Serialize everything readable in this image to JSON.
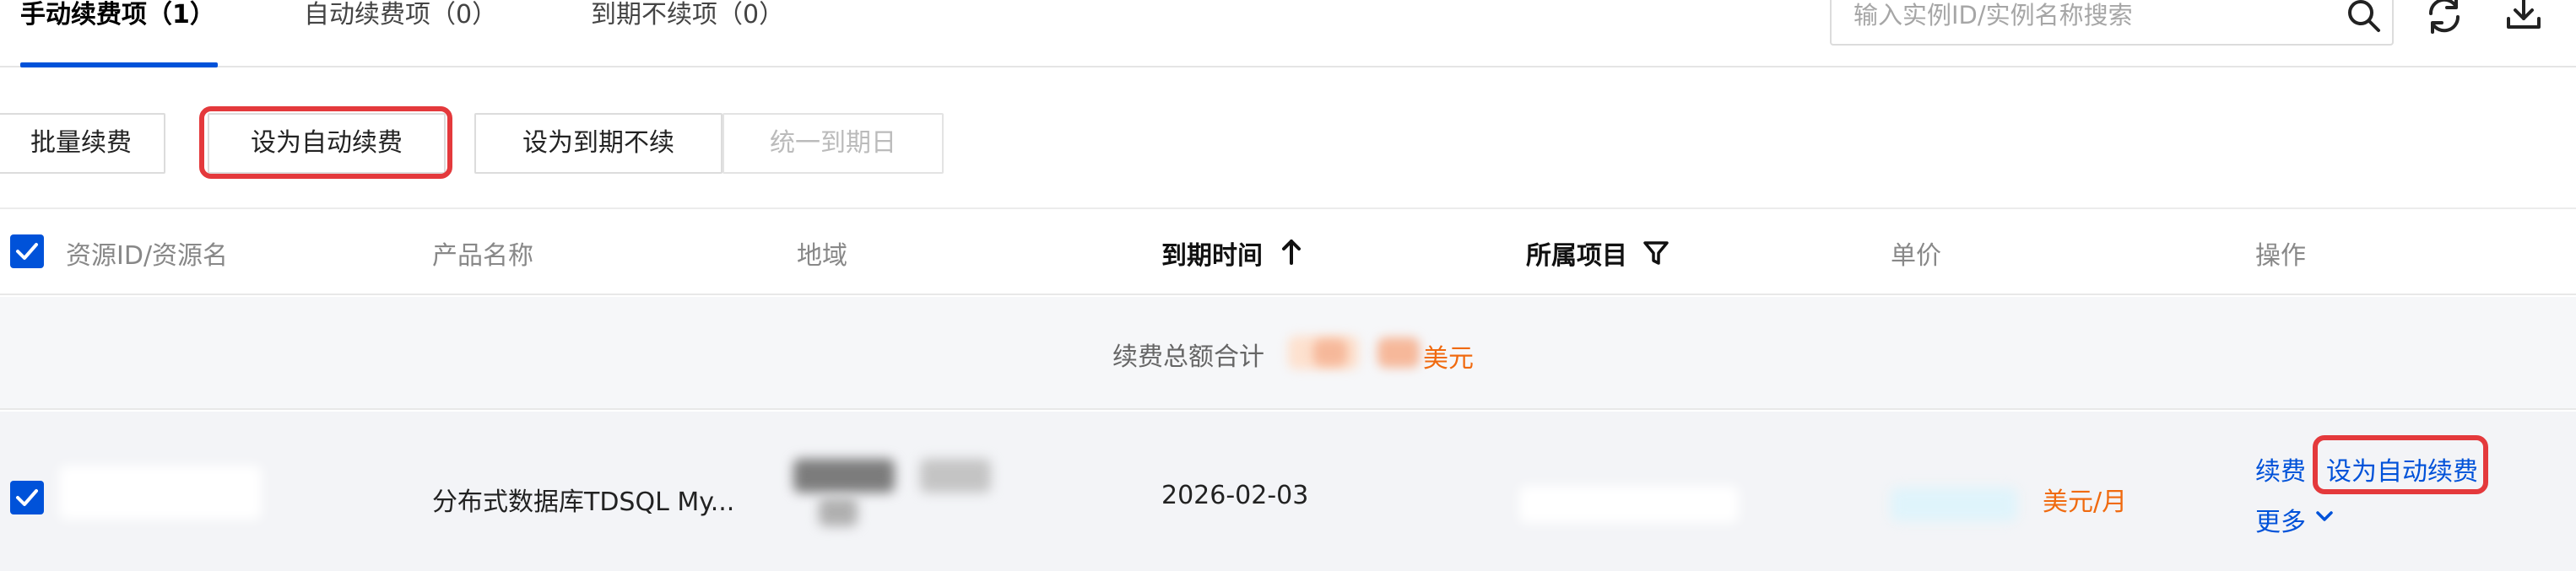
{
  "tabs": [
    {
      "label": "手动续费项（1）",
      "active": true
    },
    {
      "label": "自动续费项（0）",
      "active": false
    },
    {
      "label": "到期不续项（0）",
      "active": false
    }
  ],
  "search": {
    "placeholder": "输入实例ID/实例名称搜索"
  },
  "toolbar": {
    "batch_renew": "批量续费",
    "set_auto_renew": "设为自动续费",
    "set_no_renew": "设为到期不续",
    "unify_expiry": "统一到期日"
  },
  "table": {
    "columns": {
      "resource": "资源ID/资源名",
      "product": "产品名称",
      "region": "地域",
      "expiry": "到期时间",
      "project": "所属项目",
      "unit_price": "单价",
      "actions": "操作"
    },
    "summary": {
      "label": "续费总额合计",
      "currency": "美元"
    },
    "rows": [
      {
        "product": "分布式数据库TDSQL My...",
        "expiry": "2026-02-03",
        "price_unit": "美元/月",
        "actions": {
          "renew": "续费",
          "set_auto": "设为自动续费",
          "more": "更多"
        }
      }
    ]
  },
  "colors": {
    "accent": "#0052d9",
    "highlight": "#e4393c",
    "price": "#f06a0f"
  },
  "icons": [
    "search-icon",
    "refresh-icon",
    "download-icon",
    "sort-up-icon",
    "filter-icon",
    "chevron-down-icon",
    "checkbox-checked-icon"
  ]
}
